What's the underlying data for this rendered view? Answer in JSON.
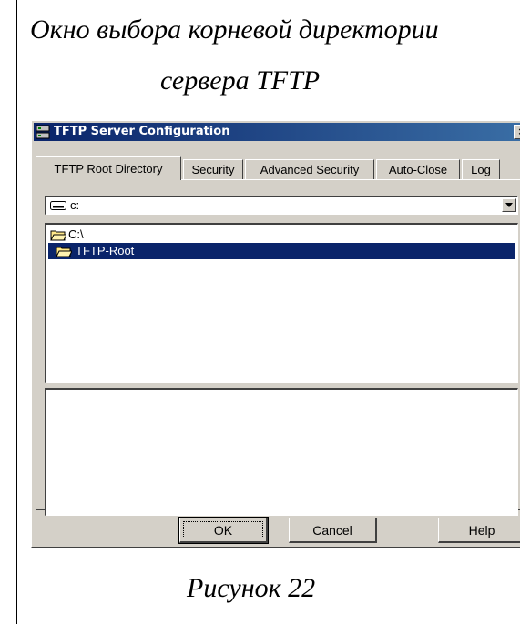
{
  "captions": {
    "line1": "Окно выбора корневой директории",
    "line2": "сервера TFTP",
    "figure": "Рисунок 22"
  },
  "dialog": {
    "title": "TFTP Server Configuration",
    "close_label": "×",
    "tabs": [
      {
        "label": "TFTP Root Directory",
        "active": true
      },
      {
        "label": "Security"
      },
      {
        "label": "Advanced Security"
      },
      {
        "label": "Auto-Close"
      },
      {
        "label": "Log"
      }
    ],
    "drive_value": "c:",
    "dir_items": [
      {
        "label": "C:\\",
        "selected": false
      },
      {
        "label": "TFTP-Root",
        "selected": true
      }
    ],
    "buttons": {
      "ok": "OK",
      "cancel": "Cancel",
      "help": "Help"
    }
  },
  "colors": {
    "selection": "#0a246a",
    "face": "#d4d0c8"
  }
}
